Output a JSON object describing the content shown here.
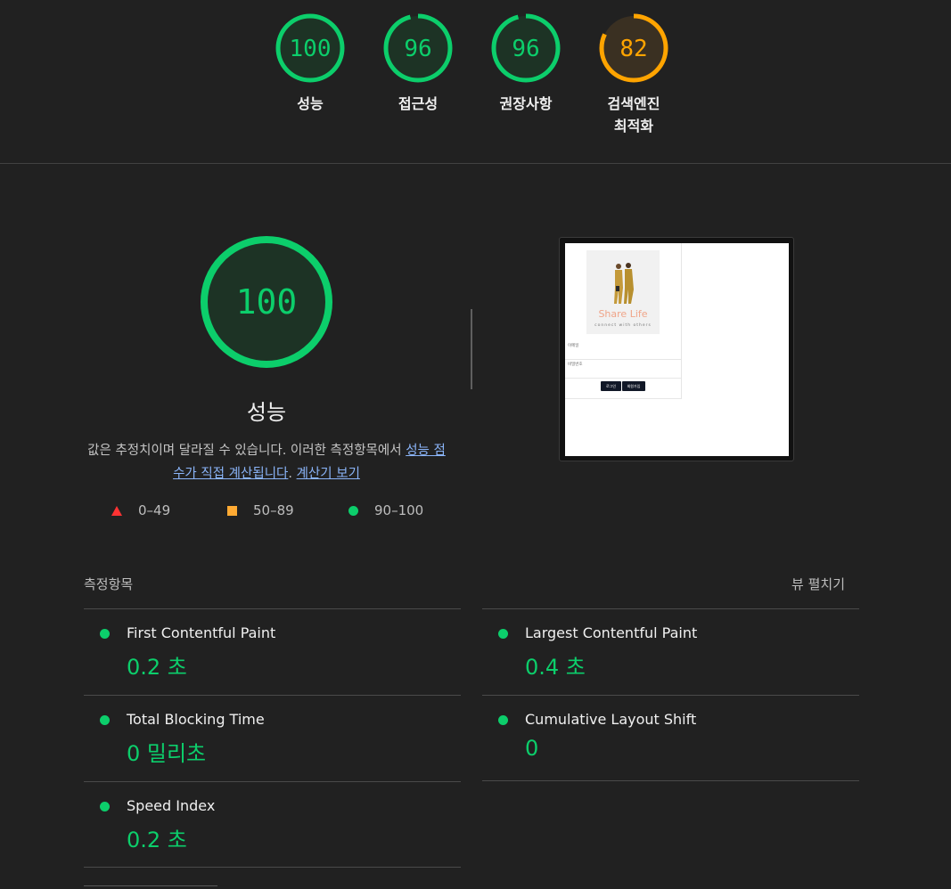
{
  "gauges": [
    {
      "score": "100",
      "label": "성능",
      "color": "#0cce6b",
      "bg": "#1d3325",
      "fraction": 1.0
    },
    {
      "score": "96",
      "label": "접근성",
      "color": "#0cce6b",
      "bg": "#1d3325",
      "fraction": 0.96
    },
    {
      "score": "96",
      "label": "권장사항",
      "color": "#0cce6b",
      "bg": "#1d3325",
      "fraction": 0.96
    },
    {
      "score": "82",
      "label": "검색엔진\n최적화",
      "color": "#ffa400",
      "bg": "#3a3022",
      "fraction": 0.82
    }
  ],
  "performance": {
    "score": "100",
    "title": "성능",
    "desc_text": "값은 추정치이며 달라질 수 있습니다. 이러한 측정항목에서 ",
    "desc_link1": "성능 점수가 직접 계산됩니다",
    "desc_sep": ". ",
    "desc_link2": "계산기 보기"
  },
  "legend": [
    {
      "range": "0–49",
      "shape": "triangle",
      "color": "#ff3333"
    },
    {
      "range": "50–89",
      "shape": "square",
      "color": "#ffaa33"
    },
    {
      "range": "90–100",
      "shape": "circle",
      "color": "#0cce6b"
    }
  ],
  "screenshot": {
    "logo": "Share Life",
    "tagline": "connect with others",
    "field1": "이메일",
    "field2": "비밀번호",
    "btn_login": "로그인",
    "btn_signup": "회원가입"
  },
  "metrics_header": {
    "title": "측정항목",
    "expand": "뷰 펼치기"
  },
  "metrics": [
    {
      "name": "First Contentful Paint",
      "value": "0.2 초"
    },
    {
      "name": "Largest Contentful Paint",
      "value": "0.4 초"
    },
    {
      "name": "Total Blocking Time",
      "value": "0 밀리초"
    },
    {
      "name": "Cumulative Layout Shift",
      "value": "0"
    },
    {
      "name": "Speed Index",
      "value": "0.2 초"
    }
  ]
}
